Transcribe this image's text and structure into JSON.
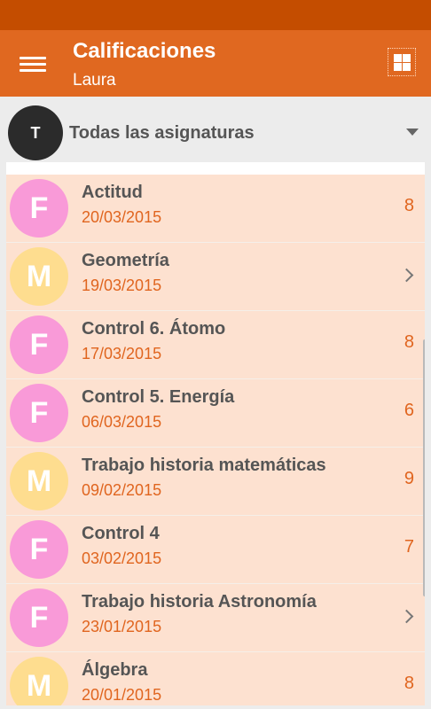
{
  "header": {
    "title": "Calificaciones",
    "subtitle": "Laura"
  },
  "filter": {
    "avatar_letter": "T",
    "label": "Todas las asignaturas"
  },
  "colors": {
    "accent": "#e06820",
    "status_bar": "#c44d00",
    "avatar_F": "#f99ad8",
    "avatar_M": "#fedd8f"
  },
  "items": [
    {
      "letter": "F",
      "title": "Actitud",
      "date": "20/03/2015",
      "grade": "8"
    },
    {
      "letter": "M",
      "title": "Geometría",
      "date": "19/03/2015",
      "grade": ""
    },
    {
      "letter": "F",
      "title": "Control 6. Átomo",
      "date": "17/03/2015",
      "grade": "8"
    },
    {
      "letter": "F",
      "title": "Control 5. Energía",
      "date": "06/03/2015",
      "grade": "6"
    },
    {
      "letter": "M",
      "title": "Trabajo historia matemáticas",
      "date": "09/02/2015",
      "grade": "9"
    },
    {
      "letter": "F",
      "title": "Control 4",
      "date": "03/02/2015",
      "grade": "7"
    },
    {
      "letter": "F",
      "title": "Trabajo historia Astronomía",
      "date": "23/01/2015",
      "grade": ""
    },
    {
      "letter": "M",
      "title": "Álgebra",
      "date": "20/01/2015",
      "grade": "8"
    }
  ]
}
